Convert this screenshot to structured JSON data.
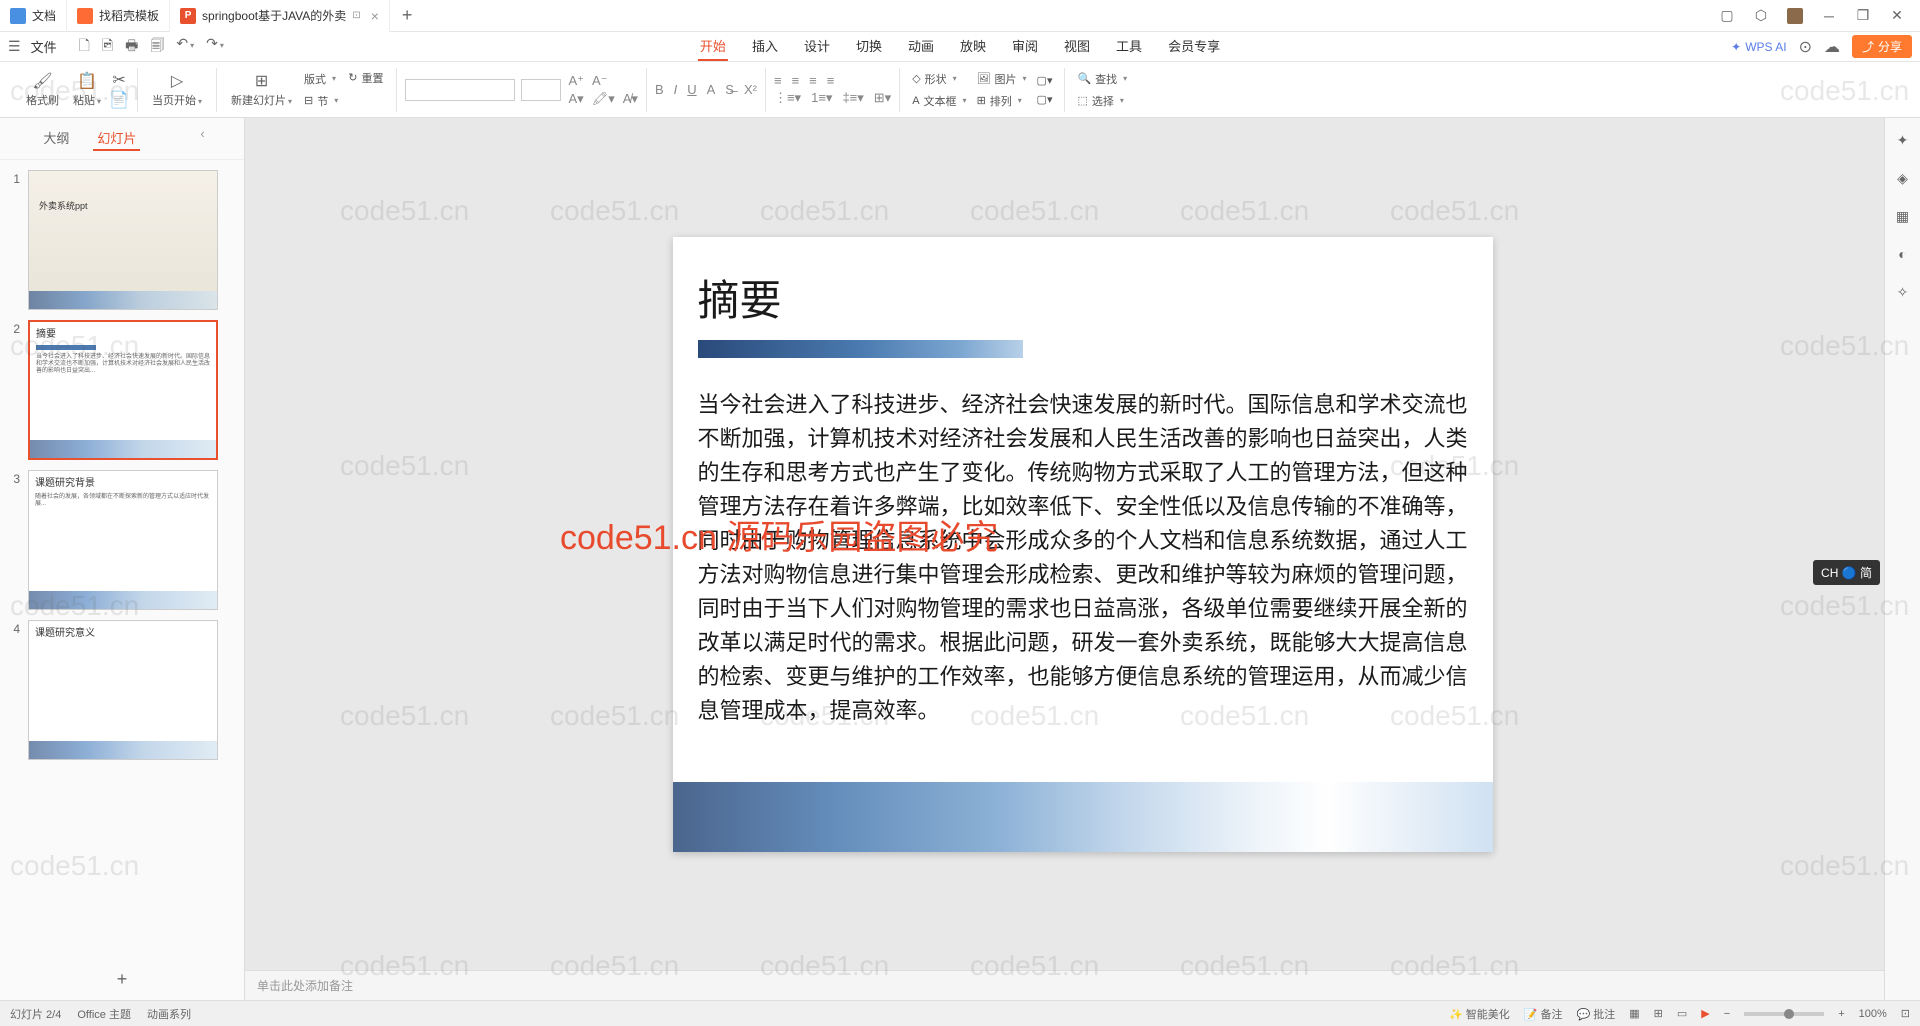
{
  "tabs": {
    "doc": "文档",
    "template": "找稻壳模板",
    "ppt": "springboot基于JAVA的外卖"
  },
  "menu": {
    "file": "文件",
    "undo_dropdown": "▾",
    "redo_dropdown": "▾"
  },
  "ribbon": {
    "start": "开始",
    "insert": "插入",
    "design": "设计",
    "transition": "切换",
    "animation": "动画",
    "slideshow": "放映",
    "review": "审阅",
    "view": "视图",
    "tools": "工具",
    "member": "会员专享"
  },
  "wps_ai": "WPS AI",
  "share": "分享",
  "toolbar": {
    "format_painter": "格式刷",
    "paste": "粘贴",
    "from_current": "当页开始",
    "new_slide": "新建幻灯片",
    "layout": "版式",
    "section": "节",
    "reset": "重置",
    "shape": "形状",
    "image": "图片",
    "textbox": "文本框",
    "arrange": "排列",
    "find": "查找",
    "select": "选择"
  },
  "sidebar": {
    "outline": "大纲",
    "slides": "幻灯片"
  },
  "thumbs": [
    {
      "num": "1",
      "title": "外卖系统ppt"
    },
    {
      "num": "2",
      "title": "摘要",
      "body": "当今社会进入了科技进步、经济社会快速发展的新时代。国际信息和学术交流也不断加强，计算机技术对经济社会发展和人民生活改善的影响也日益突出..."
    },
    {
      "num": "3",
      "title": "课题研究背景",
      "body": "随着社会的发展，各领域都在不断探索新的管理方式以适应时代发展..."
    },
    {
      "num": "4",
      "title": "课题研究意义",
      "body": ""
    }
  ],
  "slide": {
    "title": "摘要",
    "body": "当今社会进入了科技进步、经济社会快速发展的新时代。国际信息和学术交流也不断加强，计算机技术对经济社会发展和人民生活改善的影响也日益突出，人类的生存和思考方式也产生了变化。传统购物方式采取了人工的管理方法，但这种管理方法存在着许多弊端，比如效率低下、安全性低以及信息传输的不准确等，同时由于购物管理信息系统中会形成众多的个人文档和信息系统数据，通过人工方法对购物信息进行集中管理会形成检索、更改和维护等较为麻烦的管理问题，同时由于当下人们对购物管理的需求也日益高涨，各级单位需要继续开展全新的改革以满足时代的需求。根据此问题，研发一套外卖系统，既能够大大提高信息的检索、变更与维护的工作效率，也能够方便信息系统的管理运用，从而减少信息管理成本，提高效率。"
  },
  "watermark_text": "code51.cn",
  "watermark_red": "code51.cn 源码乐园盗图必究",
  "notes_placeholder": "单击此处添加备注",
  "ime": "CH 🔵 简",
  "status": {
    "left1": "幻灯片 2/4",
    "left2": "Office 主题",
    "left3": "动画系列",
    "r1": "智能美化",
    "r2": "备注",
    "r3": "批注",
    "zoom": "100%"
  }
}
